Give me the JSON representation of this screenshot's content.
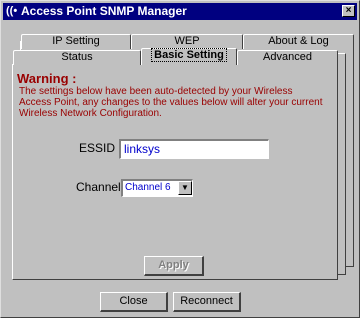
{
  "window": {
    "title": "Access Point SNMP Manager",
    "close_glyph": "×",
    "app_icon": "wireless-icon"
  },
  "tabs_top_row": [
    {
      "label": "IP Setting"
    },
    {
      "label": "WEP"
    },
    {
      "label": "About & Log"
    }
  ],
  "tabs_bottom_row": [
    {
      "label": "Status"
    },
    {
      "label": "Basic Setting",
      "active": true
    },
    {
      "label": "Advanced"
    }
  ],
  "warning": {
    "title": "Warning :",
    "text": "The settings below have been auto-detected by your Wireless Access Point, any changes to the values below will alter your current Wireless Network Configuration."
  },
  "essid": {
    "label": "ESSID",
    "value": "linksys"
  },
  "channel": {
    "label": "Channel",
    "value": "Channel 6"
  },
  "buttons": {
    "apply": "Apply",
    "close": "Close",
    "reconnect": "Reconnect"
  },
  "colors": {
    "titlebar": "#000080",
    "warning": "#990000",
    "field_text": "#0000cc",
    "face": "#c0c0c0"
  }
}
